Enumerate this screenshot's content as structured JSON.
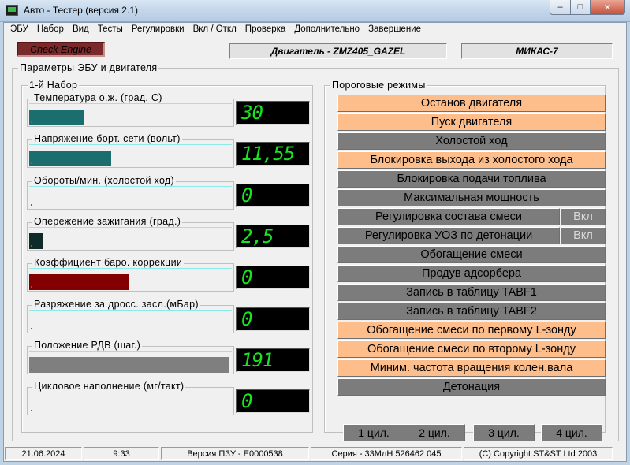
{
  "window": {
    "title": "Авто - Тестер  (версия 2.1)",
    "min": "–",
    "max": "□",
    "close": "✕"
  },
  "menu": [
    "ЭБУ",
    "Набор",
    "Вид",
    "Тесты",
    "Регулировки",
    "Вкл / Откл",
    "Проверка",
    "Дополнительно",
    "Завершение"
  ],
  "check_engine": "Check Engine",
  "engine": "Двигатель - ZMZ405_GAZEL",
  "ecu": "МИКАС-7",
  "main_frame_title": "Параметры ЭБУ и двигателя",
  "set_title": "1-й  Набор",
  "params": [
    {
      "label": "Температура  о.ж. (град. С)",
      "value": "30",
      "level": 0.27,
      "color": "#1a6e6e"
    },
    {
      "label": "Напряжение борт. сети (вольт)",
      "value": "11,55",
      "level": 0.41,
      "color": "#1a6e6e"
    },
    {
      "label": "Обороты/мин. (холостой ход)",
      "value": "0",
      "level": 0,
      "color": "#1a6e6e"
    },
    {
      "label": "Опережение зажигания (град.)",
      "value": "2,5",
      "level": 0.07,
      "color": "#0f2a28"
    },
    {
      "label": "Коэффициент баро. коррекции",
      "value": "0",
      "level": 0.5,
      "color": "#820000"
    },
    {
      "label": "Разряжение за дросс. засл.(мБар)",
      "value": "0",
      "level": 0,
      "color": "#1a6e6e"
    },
    {
      "label": "Положение РДВ (шаг.)",
      "value": "191",
      "level": 1.0,
      "color": "#7f7f7f"
    },
    {
      "label": "Цикловое наполнение (мг/такт)",
      "value": "0",
      "level": 0,
      "color": "#1a6e6e"
    }
  ],
  "threshold_title": "Пороговые режимы",
  "thresholds": [
    {
      "label": "Останов двигателя",
      "state": "on"
    },
    {
      "label": "Пуск двигателя",
      "state": "on"
    },
    {
      "label": "Холостой ход",
      "state": "off"
    },
    {
      "label": "Блокировка выхода из холостого хода",
      "state": "on"
    },
    {
      "label": "Блокировка подачи топлива",
      "state": "off"
    },
    {
      "label": "Максимальная мощность",
      "state": "off"
    },
    {
      "label": "Регулировка состава смеси",
      "state": "off",
      "toggle": "Вкл"
    },
    {
      "label": "Регулировка УОЗ по детонации",
      "state": "off",
      "toggle": "Вкл"
    },
    {
      "label": "Обогащение смеси",
      "state": "off"
    },
    {
      "label": "Продув адсорбера",
      "state": "off"
    },
    {
      "label": "Запись в таблицу TABF1",
      "state": "off"
    },
    {
      "label": "Запись в таблицу TABF2",
      "state": "off"
    },
    {
      "label": "Обогащение смеси по первому L-зонду",
      "state": "on"
    },
    {
      "label": "Обогащение смеси по второму L-зонду",
      "state": "on"
    },
    {
      "label": "Миним. частота вращения колен.вала",
      "state": "on"
    },
    {
      "label": "Детонация",
      "state": "off"
    }
  ],
  "cylinders": [
    "1 цил.",
    "2 цил.",
    "3 цил.",
    "4 цил."
  ],
  "status": {
    "date": "21.06.2024",
    "time": "9:33",
    "rom": "Версия ПЗУ - E0000538",
    "serial": "Серия - 33МлН 526462 045",
    "copyright": "(C) Copyright    ST&ST  Ltd 2003"
  }
}
